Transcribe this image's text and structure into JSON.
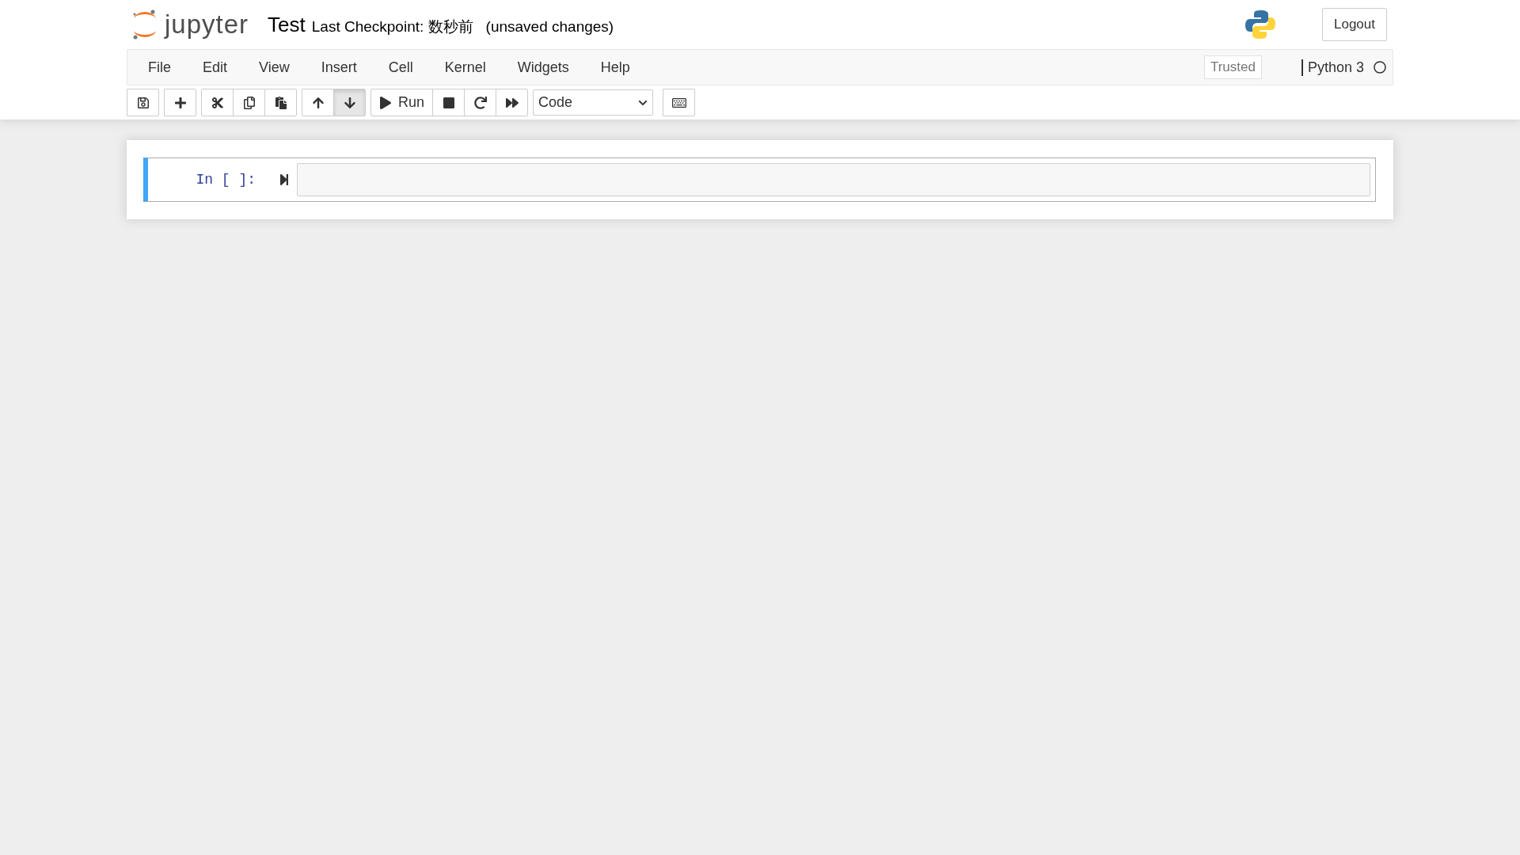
{
  "header": {
    "logo_text": "jupyter",
    "notebook_name": "Test",
    "checkpoint": "Last Checkpoint: 数秒前",
    "autosave_status": "(unsaved changes)",
    "logout": "Logout"
  },
  "menu": [
    "File",
    "Edit",
    "View",
    "Insert",
    "Cell",
    "Kernel",
    "Widgets",
    "Help"
  ],
  "trusted": "Trusted",
  "kernel": {
    "name": "Python 3",
    "busy": false
  },
  "toolbar": [
    {
      "buttons": [
        {
          "kind": "save",
          "pressed": false
        }
      ]
    },
    {
      "buttons": [
        {
          "kind": "add",
          "pressed": false
        }
      ]
    },
    {
      "buttons": [
        {
          "kind": "cut",
          "pressed": false
        },
        {
          "kind": "copy",
          "pressed": false
        },
        {
          "kind": "paste",
          "pressed": false
        }
      ]
    },
    {
      "buttons": [
        {
          "kind": "up",
          "pressed": false
        },
        {
          "kind": "down",
          "pressed": true
        }
      ]
    },
    {
      "buttons": [
        {
          "kind": "run",
          "label": "Run",
          "pressed": false
        },
        {
          "kind": "stop",
          "pressed": false
        },
        {
          "kind": "restart",
          "pressed": false
        },
        {
          "kind": "restart_run",
          "pressed": false
        }
      ]
    }
  ],
  "cell_type": "Code",
  "cells": [
    {
      "prompt": "In [ ]:",
      "selected": true
    }
  ]
}
